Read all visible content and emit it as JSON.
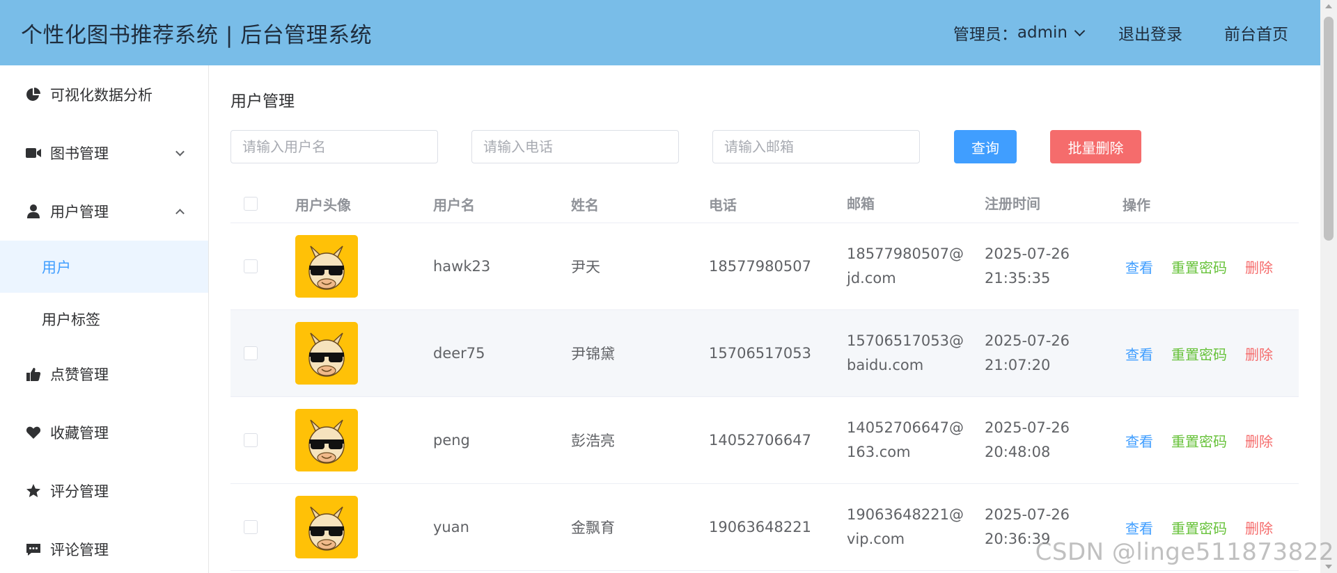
{
  "header": {
    "title": "个性化图书推荐系统 | 后台管理系统",
    "admin_label": "管理员：",
    "admin_name": "admin",
    "logout": "退出登录",
    "frontpage": "前台首页"
  },
  "sidebar": {
    "items": [
      {
        "label": "可视化数据分析",
        "icon": "pie-chart-icon"
      },
      {
        "label": "图书管理",
        "icon": "video-camera-icon"
      },
      {
        "label": "用户管理",
        "icon": "user-icon"
      },
      {
        "label": "点赞管理",
        "icon": "thumbs-up-icon"
      },
      {
        "label": "收藏管理",
        "icon": "heart-icon"
      },
      {
        "label": "评分管理",
        "icon": "star-icon"
      },
      {
        "label": "评论管理",
        "icon": "comment-icon"
      }
    ],
    "subitems": [
      {
        "label": "用户",
        "active": true
      },
      {
        "label": "用户标签",
        "active": false
      }
    ]
  },
  "main": {
    "title": "用户管理",
    "search": {
      "username_placeholder": "请输入用户名",
      "phone_placeholder": "请输入电话",
      "email_placeholder": "请输入邮箱",
      "query_label": "查询",
      "batch_delete_label": "批量删除"
    },
    "table": {
      "columns": [
        "用户头像",
        "用户名",
        "姓名",
        "电话",
        "邮箱",
        "注册时间",
        "操作"
      ],
      "rows": [
        {
          "username": "hawk23",
          "name": "尹天",
          "phone": "18577980507",
          "email_1": "18577980507@",
          "email_2": "jd.com",
          "date": "2025-07-26",
          "time": "21:35:35"
        },
        {
          "username": "deer75",
          "name": "尹锦黛",
          "phone": "15706517053",
          "email_1": "15706517053@",
          "email_2": "baidu.com",
          "date": "2025-07-26",
          "time": "21:07:20"
        },
        {
          "username": "peng",
          "name": "彭浩亮",
          "phone": "14052706647",
          "email_1": "14052706647@",
          "email_2": "163.com",
          "date": "2025-07-26",
          "time": "20:48:08"
        },
        {
          "username": "yuan",
          "name": "金飘育",
          "phone": "19063648221",
          "email_1": "19063648221@",
          "email_2": "vip.com",
          "date": "2025-07-26",
          "time": "20:36:39"
        }
      ],
      "ops": {
        "view": "查看",
        "reset": "重置密码",
        "delete": "删除"
      }
    }
  },
  "watermark": "CSDN @linge511873822",
  "colors": {
    "header_bg": "#79bde8",
    "primary": "#409eff",
    "success": "#67c23a",
    "danger": "#f56c6c",
    "avatar_bg": "#ffc107"
  }
}
